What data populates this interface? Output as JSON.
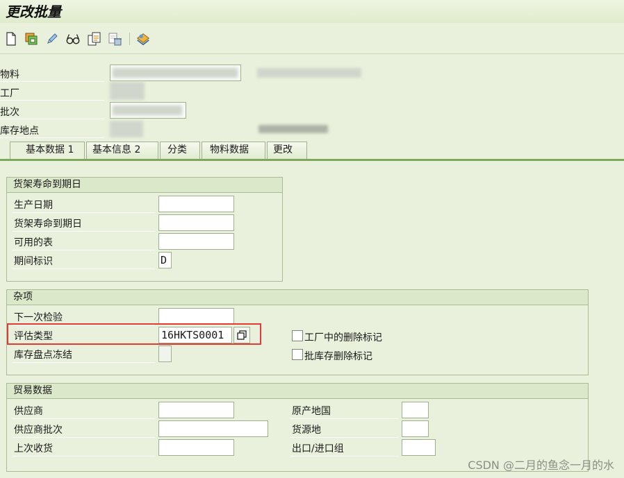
{
  "title": "更改批量",
  "toolbar": {
    "icons": [
      "new-document-icon",
      "change-icon",
      "edit-pencil-icon",
      "display-glasses-icon",
      "copy-icon",
      "delete-icon",
      "classification-icon"
    ]
  },
  "header": {
    "material_label": "物料",
    "plant_label": "工厂",
    "batch_label": "批次",
    "storage_location_label": "库存地点"
  },
  "tabs": [
    {
      "label": "基本数据 1"
    },
    {
      "label": "基本信息 2"
    },
    {
      "label": "分类"
    },
    {
      "label": "物料数据"
    },
    {
      "label": "更改"
    }
  ],
  "shelf_life": {
    "title": "货架寿命到期日",
    "production_date_label": "生产日期",
    "production_date_value": "",
    "sled_label": "货架寿命到期日",
    "sled_value": "",
    "available_label": "可用的表",
    "available_value": "",
    "period_label": "期间标识",
    "period_value": "D"
  },
  "misc": {
    "title": "杂项",
    "next_inspection_label": "下一次检验",
    "next_inspection_value": "",
    "valuation_type_label": "评估类型",
    "valuation_type_value": "16HKTS0001",
    "stock_freeze_label": "库存盘点冻结",
    "plant_deletion_label": "工厂中的删除标记",
    "batch_deletion_label": "批库存删除标记"
  },
  "trade": {
    "title": "贸易数据",
    "vendor_label": "供应商",
    "vendor_value": "",
    "vendor_batch_label": "供应商批次",
    "vendor_batch_value": "",
    "last_gr_label": "上次收货",
    "last_gr_value": "",
    "country_of_origin_label": "原产地国",
    "country_of_origin_value": "",
    "region_of_origin_label": "货源地",
    "region_of_origin_value": "",
    "export_import_group_label": "出口/进口组",
    "export_import_group_value": ""
  },
  "watermark": "CSDN @二月的鱼念一月的水",
  "colors": {
    "background": "#e9f1dc",
    "highlight": "#e53935",
    "tab_underline": "#7da85a"
  }
}
